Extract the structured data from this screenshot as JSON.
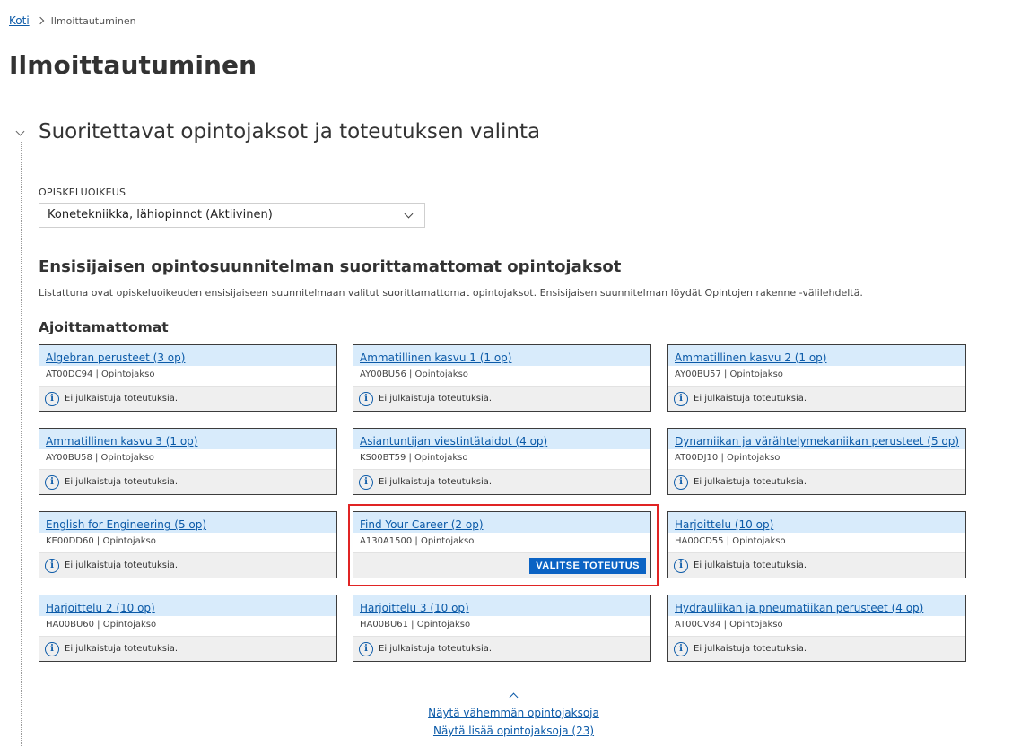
{
  "breadcrumb": {
    "home": "Koti",
    "current": "Ilmoittautuminen"
  },
  "page_title": "Ilmoittautuminen",
  "section": {
    "title": "Suoritettavat opintojaksot ja toteutuksen valinta",
    "field_label": "OPISKELUOIKEUS",
    "selected_right": "Konetekniikka, lähiopinnot (Aktiivinen)"
  },
  "subsection": {
    "title": "Ensisijaisen opintosuunnitelman suorittamattomat opintojaksot",
    "description": "Listattuna ovat opiskeluoikeuden ensisijaiseen suunnitelmaan valitut suorittamattomat opintojaksot. Ensisijaisen suunnitelman löydät Opintojen rakenne -välilehdeltä.",
    "group_title": "Ajoittamattomat"
  },
  "info_symbol": "i",
  "no_implementations_text": "Ei julkaistuja toteutuksia.",
  "select_button_label": "VALITSE TOTEUTUS",
  "cards": [
    {
      "title": "Algebran perusteet (3 op)",
      "meta": "AT00DC94 | Opintojakso"
    },
    {
      "title": "Ammatillinen kasvu 1 (1 op)",
      "meta": "AY00BU56 | Opintojakso"
    },
    {
      "title": "Ammatillinen kasvu 2 (1 op)",
      "meta": "AY00BU57 | Opintojakso"
    },
    {
      "title": "Ammatillinen kasvu 3 (1 op)",
      "meta": "AY00BU58 | Opintojakso"
    },
    {
      "title": "Asiantuntijan viestintätaidot (4 op)",
      "meta": "KS00BT59 | Opintojakso"
    },
    {
      "title": "Dynamiikan ja värähtelymekaniikan perusteet (5 op)",
      "meta": "AT00DJ10 | Opintojakso"
    },
    {
      "title": "English for Engineering (5 op)",
      "meta": "KE00DD60 | Opintojakso"
    },
    {
      "title": "Find Your Career (2 op)",
      "meta": "A130A1500 | Opintojakso"
    },
    {
      "title": "Harjoittelu (10 op)",
      "meta": "HA00CD55 | Opintojakso"
    },
    {
      "title": "Harjoittelu 2 (10 op)",
      "meta": "HA00BU60 | Opintojakso"
    },
    {
      "title": "Harjoittelu 3 (10 op)",
      "meta": "HA00BU61 | Opintojakso"
    },
    {
      "title": "Hydrauliikan ja pneumatiikan perusteet (4 op)",
      "meta": "AT00CV84 | Opintojakso"
    }
  ],
  "bottom_links": {
    "show_less": "Näytä vähemmän opintojaksoja",
    "show_more": "Näytä lisää opintojaksoja (23)"
  }
}
